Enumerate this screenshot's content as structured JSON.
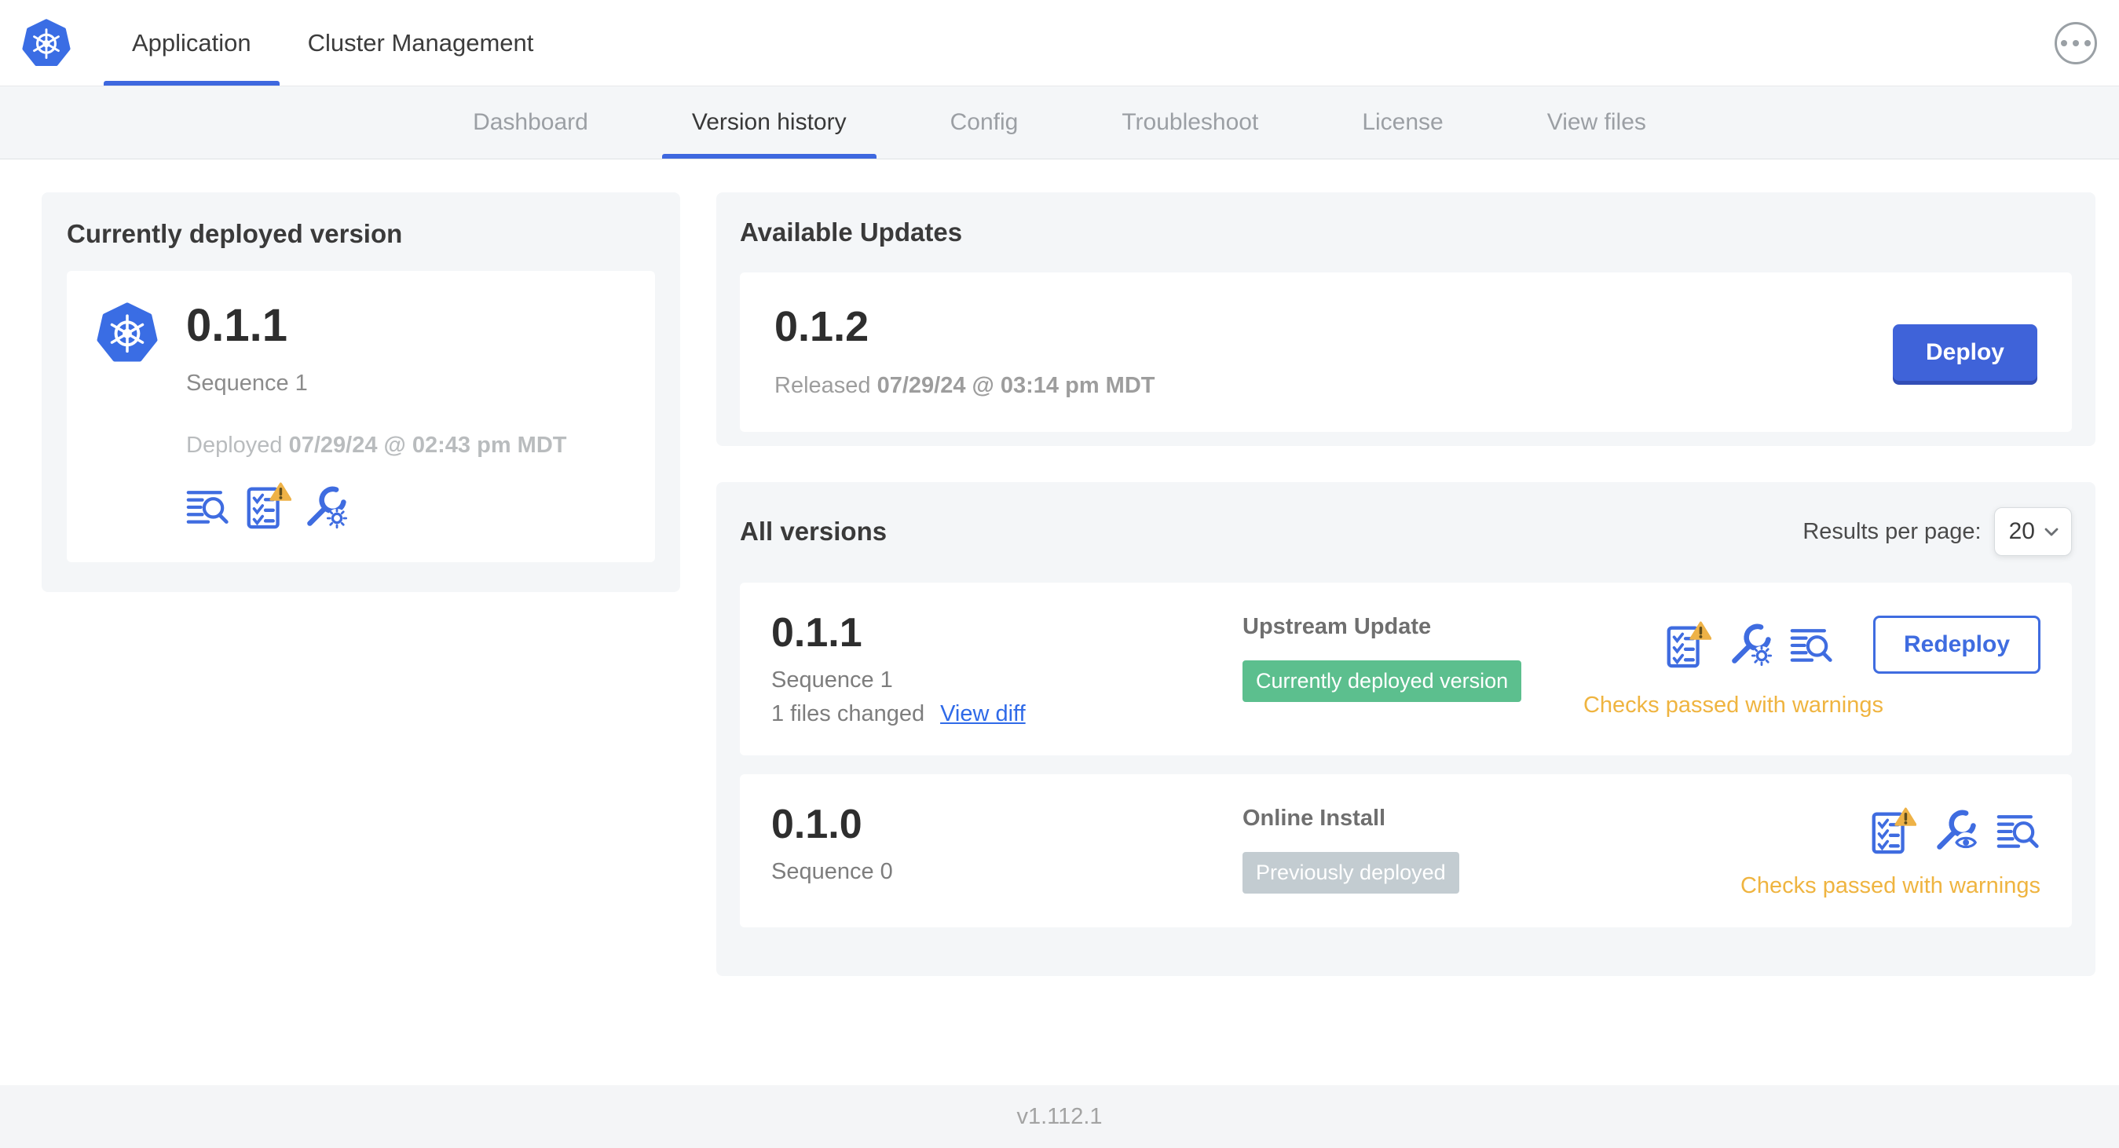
{
  "header": {
    "tabs": [
      {
        "label": "Application",
        "active": true
      },
      {
        "label": "Cluster Management",
        "active": false
      }
    ],
    "menu_icon": "ellipsis-icon",
    "logo_icon": "kubernetes-logo"
  },
  "nav": {
    "tabs": [
      "Dashboard",
      "Version history",
      "Config",
      "Troubleshoot",
      "License",
      "View files"
    ],
    "active": "Version history"
  },
  "current": {
    "title": "Currently deployed version",
    "version": "0.1.1",
    "sequence": "Sequence 1",
    "deployed_prefix": "Deployed",
    "deployed_date": "07/29/24 @ 02:43 pm MDT",
    "icons": [
      "release-notes-icon",
      "preflight-checks-warning-icon",
      "edit-config-icon"
    ]
  },
  "available": {
    "title": "Available Updates",
    "version": "0.1.2",
    "released_prefix": "Released",
    "released_date": "07/29/24 @ 03:14 pm MDT",
    "deploy_label": "Deploy"
  },
  "all_versions": {
    "title": "All versions",
    "results_per_page_label": "Results per page:",
    "results_per_page_value": "20",
    "rows": [
      {
        "version": "0.1.1",
        "sequence": "Sequence 1",
        "files_changed": "1 files changed",
        "view_diff_label": "View diff",
        "source": "Upstream Update",
        "badge": {
          "label": "Currently deployed version",
          "color": "green"
        },
        "icons": [
          "preflight-checks-warning-icon",
          "edit-config-icon",
          "release-notes-icon"
        ],
        "status": "Checks passed with warnings",
        "action_label": "Redeploy"
      },
      {
        "version": "0.1.0",
        "sequence": "Sequence 0",
        "source": "Online Install",
        "badge": {
          "label": "Previously deployed",
          "color": "gray"
        },
        "icons": [
          "preflight-checks-warning-icon",
          "view-config-icon",
          "release-notes-icon"
        ],
        "status": "Checks passed with warnings"
      }
    ]
  },
  "footer": {
    "app_version": "v1.112.1"
  },
  "colors": {
    "accent_blue": "#3e68df",
    "icon_blue": "#3f6ce0",
    "badge_green": "#5cbf8e",
    "badge_gray": "#c3ccd1",
    "warning_amber": "#eeb247",
    "status_amber": "#efb440",
    "panel_gray": "#f4f6f8"
  }
}
